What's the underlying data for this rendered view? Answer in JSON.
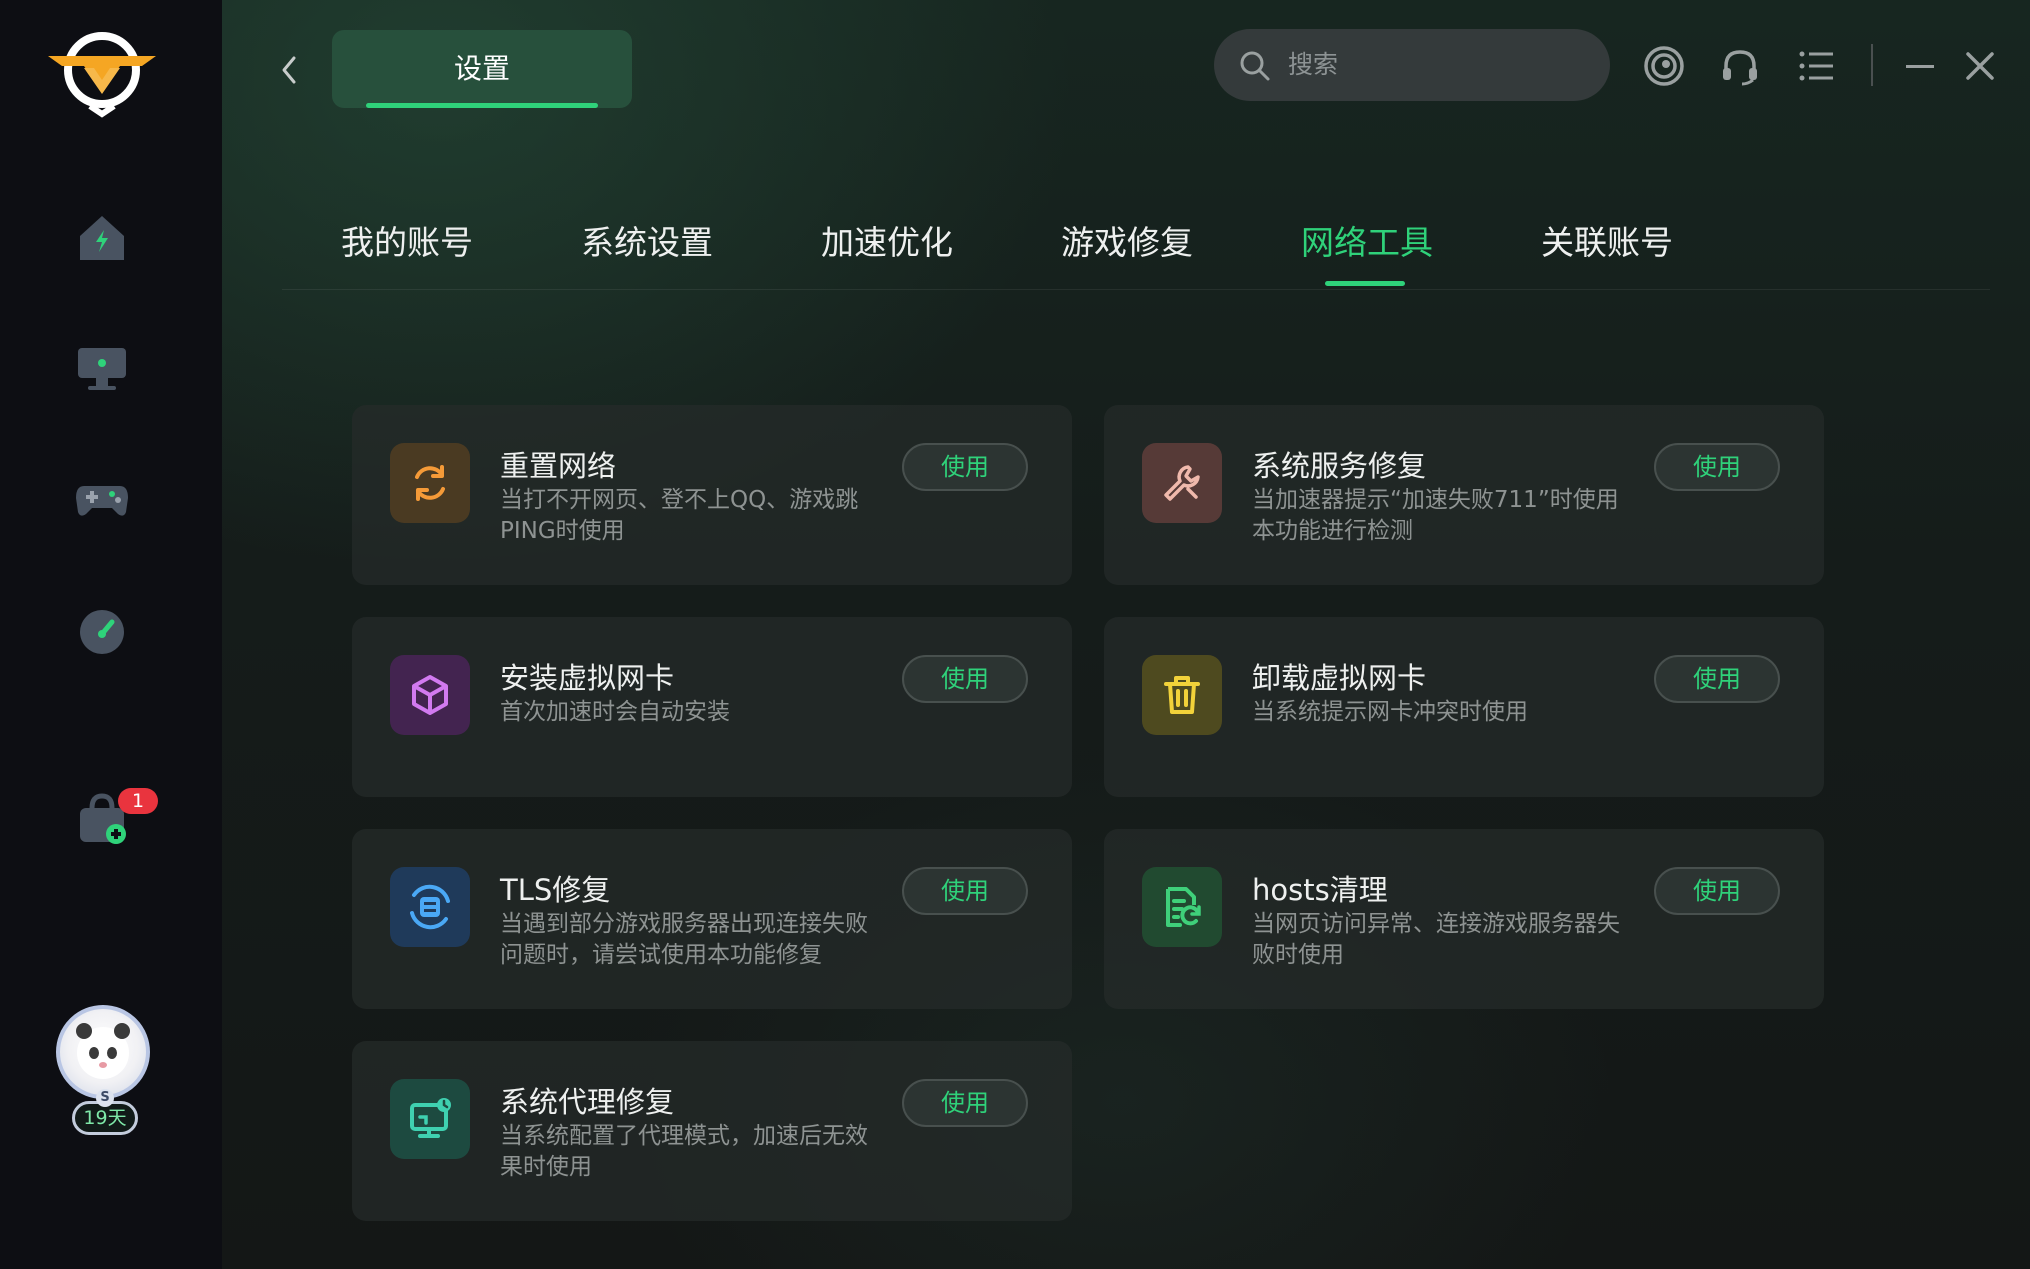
{
  "sidebar": {
    "badge_count": "1",
    "vip_days": "19天",
    "vip_level": "S",
    "nav_icons": [
      "home-icon",
      "monitor-icon",
      "gamepad-icon",
      "speedometer-icon",
      "bag-icon"
    ]
  },
  "header": {
    "title": "设置",
    "search_placeholder": "搜索",
    "icons": [
      "ubisoft-icon",
      "headset-icon",
      "menu-list-icon",
      "minimize-icon",
      "close-icon"
    ]
  },
  "tabs": [
    {
      "label": "我的账号",
      "active": false
    },
    {
      "label": "系统设置",
      "active": false
    },
    {
      "label": "加速优化",
      "active": false
    },
    {
      "label": "游戏修复",
      "active": false
    },
    {
      "label": "网络工具",
      "active": true
    },
    {
      "label": "关联账号",
      "active": false
    }
  ],
  "tools": [
    {
      "title": "重置网络",
      "desc": "当打不开网页、登不上QQ、游戏跳PING时使用",
      "button": "使用",
      "icon": "refresh-icon",
      "icon_color": "#f59a38",
      "icon_bg": "#4a3a22"
    },
    {
      "title": "系统服务修复",
      "desc": "当加速器提示“加速失败711”时使用本功能进行检测",
      "button": "使用",
      "icon": "wrench-icon",
      "icon_color": "#f0b9ac",
      "icon_bg": "#563a37"
    },
    {
      "title": "安装虚拟网卡",
      "desc": "首次加速时会自动安装",
      "button": "使用",
      "icon": "cube-icon",
      "icon_color": "#d27af0",
      "icon_bg": "#432450"
    },
    {
      "title": "卸载虚拟网卡",
      "desc": "当系统提示网卡冲突时使用",
      "button": "使用",
      "icon": "trash-icon",
      "icon_color": "#f2d23a",
      "icon_bg": "#4e4a1f"
    },
    {
      "title": "TLS修复",
      "desc": "当遇到部分游戏服务器出现连接失败问题时，请尝试使用本功能修复",
      "button": "使用",
      "icon": "tls-repair-icon",
      "icon_color": "#4aa8f5",
      "icon_bg": "#1f3a5a"
    },
    {
      "title": "hosts清理",
      "desc": "当网页访问异常、连接游戏服务器失败时使用",
      "button": "使用",
      "icon": "file-clean-icon",
      "icon_color": "#3fd07a",
      "icon_bg": "#214a30"
    },
    {
      "title": "系统代理修复",
      "desc": "当系统配置了代理模式，加速后无效果时使用",
      "button": "使用",
      "icon": "monitor-repair-icon",
      "icon_color": "#3fd0b0",
      "icon_bg": "#1d4a40"
    }
  ],
  "colors": {
    "accent": "#2fd27a",
    "sidebar_bg": "#0d0e13",
    "logo_orange": "#f5a623"
  }
}
